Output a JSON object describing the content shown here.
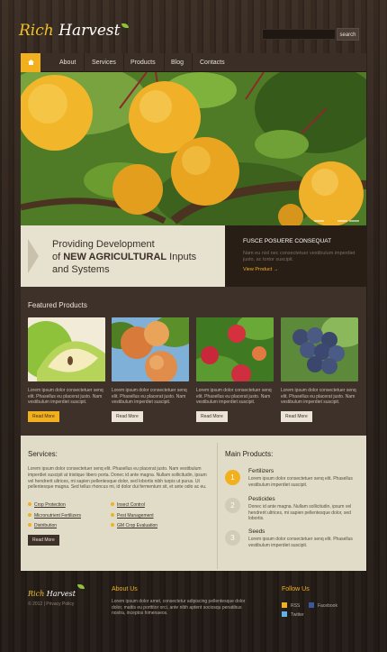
{
  "header": {
    "logo_part1": "Rich",
    "logo_part2": "Harvest",
    "search_button": "search"
  },
  "nav": {
    "home_icon": "home-icon",
    "items": [
      "About",
      "Services",
      "Products",
      "Blog",
      "Contacts"
    ]
  },
  "hero": {
    "title_line1": "Providing Development",
    "title_line2_a": "of ",
    "title_line2_b": "NEW AGRICULTURAL",
    "title_line2_c": " Inputs",
    "title_line3": "and Systems",
    "side_heading": "FUSCE POSUERE CONSEQUAT",
    "side_text": "Nam eu nisl nec consectetuer vestibulum imperdiet justo, ac tortor suscipit.",
    "side_link": "View Product  →",
    "slides": 4,
    "active_slide": 1
  },
  "featured": {
    "heading": "Featured Products",
    "products": [
      {
        "text": "Lorem ipsum dolor consectetuer senq elit. Phasellus eu placerat justo. Nam vestibulum imperdiet suscipit.",
        "button": "Read More",
        "image": "apple-image"
      },
      {
        "text": "Lorem ipsum dolor consectetuer senq elit. Phasellus eu placerat justo. Nam vestibulum imperdiet suscipit.",
        "button": "Read More",
        "image": "peach-image"
      },
      {
        "text": "Lorem ipsum dolor consectetuer senq elit. Phasellus eu placerat justo. Nam vestibulum imperdiet suscipit.",
        "button": "Read More",
        "image": "raspberry-image"
      },
      {
        "text": "Lorem ipsum dolor consectetuer senq elit. Phasellus eu placerat justo. Nam vestibulum imperdiet suscipit.",
        "button": "Read More",
        "image": "grapes-image"
      }
    ]
  },
  "services": {
    "heading": "Services:",
    "text": "Lorem ipsum dolor consectetuer senq elit. Phasellus eu placerat justo. Nam vestibulum imperdiet suscipit at tristique libero porta. Donec id ante magna. Nullam sollicitudin, ipsum vel hendrerit ultrices, mi sapien pellentesque dolor, sed lobortis nibh turpis ut purus. Ut pellentesque magna. Sed tellus rhoncus mi, id dolor dui fermentum sit, et ante odio ac eu.",
    "items": [
      "Crop Protection",
      "Micronutrient Fertilizers",
      "Distribution",
      "Insect Control",
      "Pest Management",
      "GM Crop Evaluation"
    ],
    "button": "Read More"
  },
  "main_products": {
    "heading": "Main Products:",
    "items": [
      {
        "num": "1",
        "title": "Fertilizers",
        "text": "Lorem ipsum dolor consectetuer senq elit. Phasellus vestibulum imperdiet suscipit."
      },
      {
        "num": "2",
        "title": "Pesticides",
        "text": "Donec id ante magna. Nullam sollicitudin, ipsum vel hendrerit ultrices, mi sapien pellentesque dolor, sed lobortis."
      },
      {
        "num": "3",
        "title": "Seeds",
        "text": "Lorem ipsum dolor consectetuer senq elit. Phasellus vestibulum imperdiet suscipit."
      }
    ]
  },
  "footer": {
    "logo_part1": "Rich",
    "logo_part2": "Harvest",
    "copyright": "© 2012   |   Privacy Policy",
    "about_heading": "About Us",
    "about_text": "Lorem ipsum dolor amet, consectetur adipiscing pellentesque dolor dolor, mattis eu porttitor orci, ante nibh aptent sociosqu penatibus nostra, inceptos himenaeos.",
    "follow_heading": "Follow Us",
    "social": [
      "RSS",
      "Facebook",
      "Twitter"
    ]
  },
  "colors": {
    "accent": "#f2b01e",
    "dark_brown": "#3e3129",
    "cream": "#e1dcc7"
  }
}
